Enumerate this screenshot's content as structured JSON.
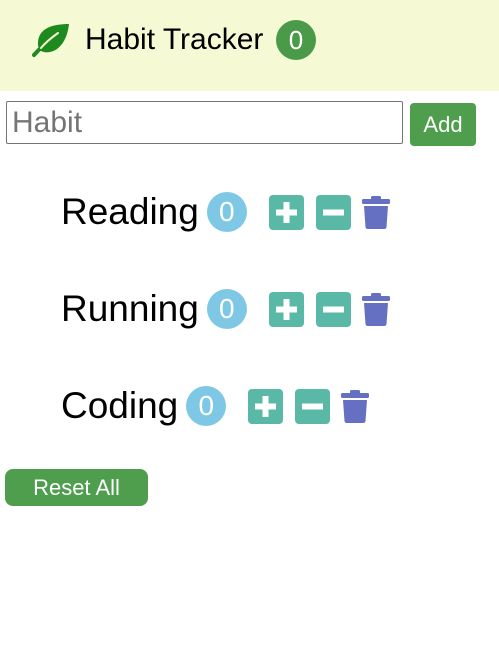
{
  "header": {
    "title": "Habit Tracker",
    "total_count": "0",
    "icon": "leaf-icon",
    "background_color": "#f5fad5",
    "icon_color": "#1e8a1e",
    "badge_color": "#4a9a4a"
  },
  "form": {
    "input_placeholder": "Habit",
    "input_value": "",
    "add_label": "Add"
  },
  "habits": [
    {
      "name": "Reading",
      "count": "0"
    },
    {
      "name": "Running",
      "count": "0"
    },
    {
      "name": "Coding",
      "count": "0"
    }
  ],
  "icons": {
    "increment": "plus-square-icon",
    "decrement": "minus-square-icon",
    "delete": "trash-icon"
  },
  "colors": {
    "count_badge": "#7ec8e6",
    "action_buttons": "#5ab8a6",
    "delete_icon": "#6670c2",
    "primary_button": "#4e9e4e"
  },
  "footer": {
    "reset_label": "Reset All"
  }
}
